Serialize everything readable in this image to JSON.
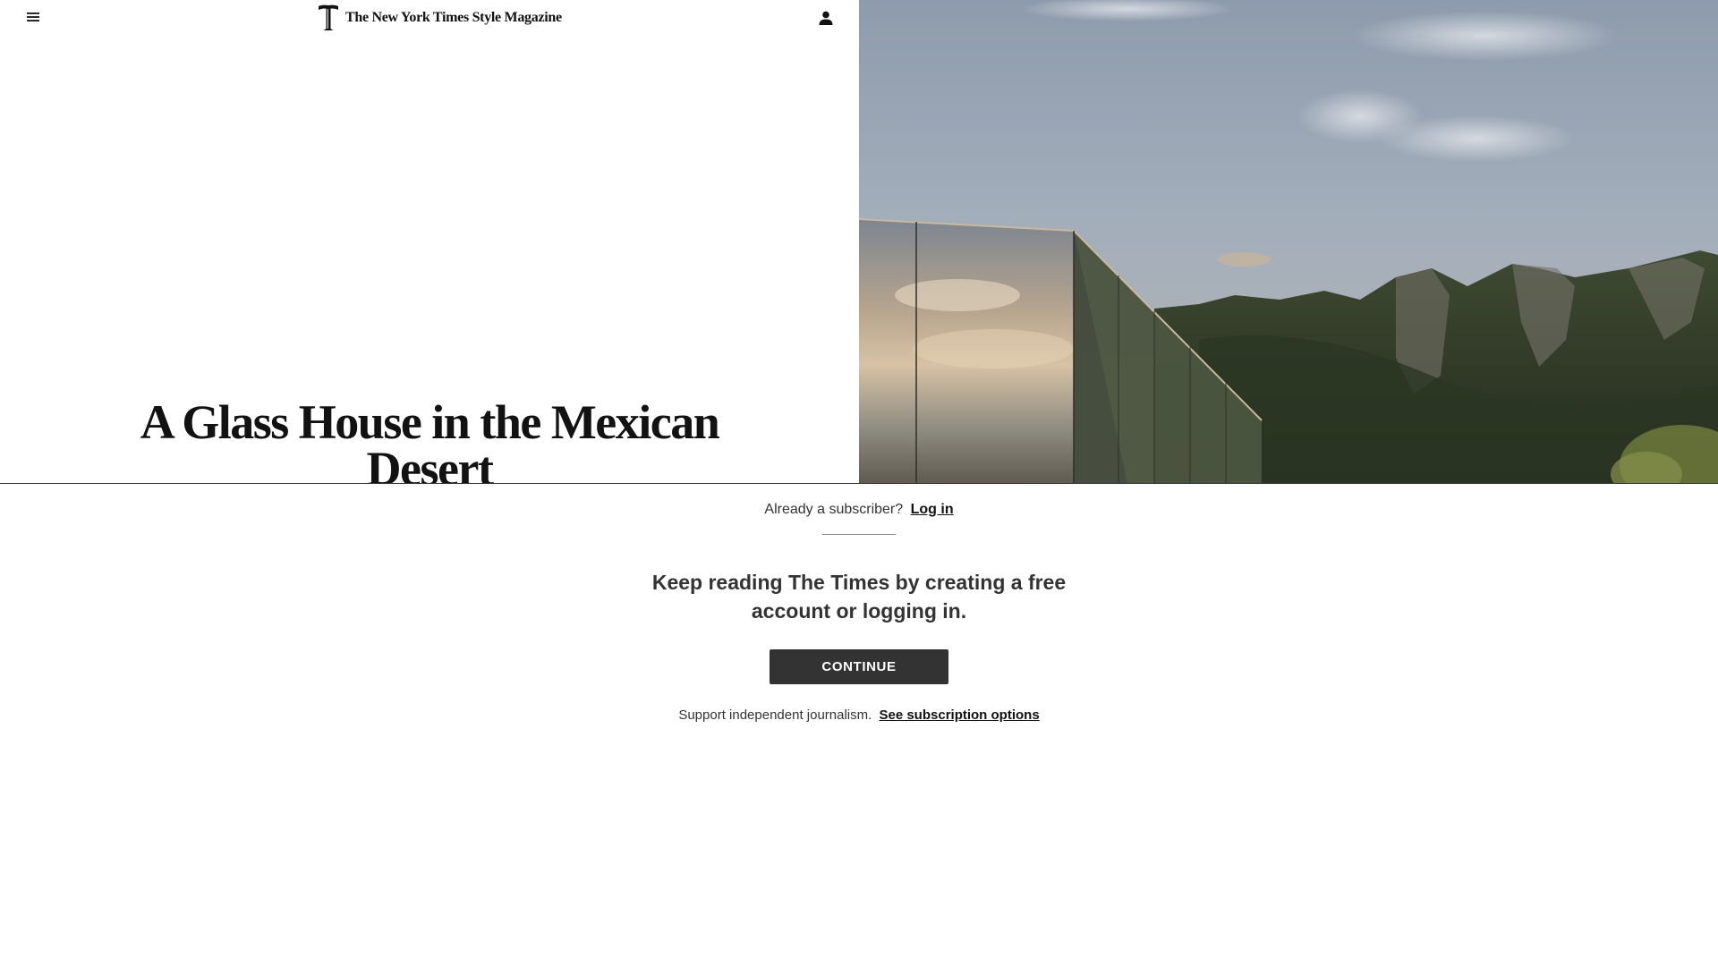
{
  "masthead": {
    "title": "The New York Times Style Magazine",
    "logo_icon": "t-magazine-logo-icon"
  },
  "header": {
    "menu_icon": "hamburger-menu-icon",
    "account_icon": "user-account-icon"
  },
  "article": {
    "headline": "A Glass House in the Mexican Desert"
  },
  "hero": {
    "alt": "Mirrored glass house reflecting clouds against rocky green hills"
  },
  "gate": {
    "subscriber_prompt": "Already a subscriber?",
    "login_label": "Log in",
    "heading": "Keep reading The Times by creating a free account or logging in.",
    "continue_label": "CONTINUE",
    "support_text": "Support independent journalism.",
    "subscription_link": "See subscription options"
  },
  "colors": {
    "text": "#121212",
    "button_bg": "#333333",
    "button_text": "#ffffff",
    "divider": "#8a8a8a"
  }
}
